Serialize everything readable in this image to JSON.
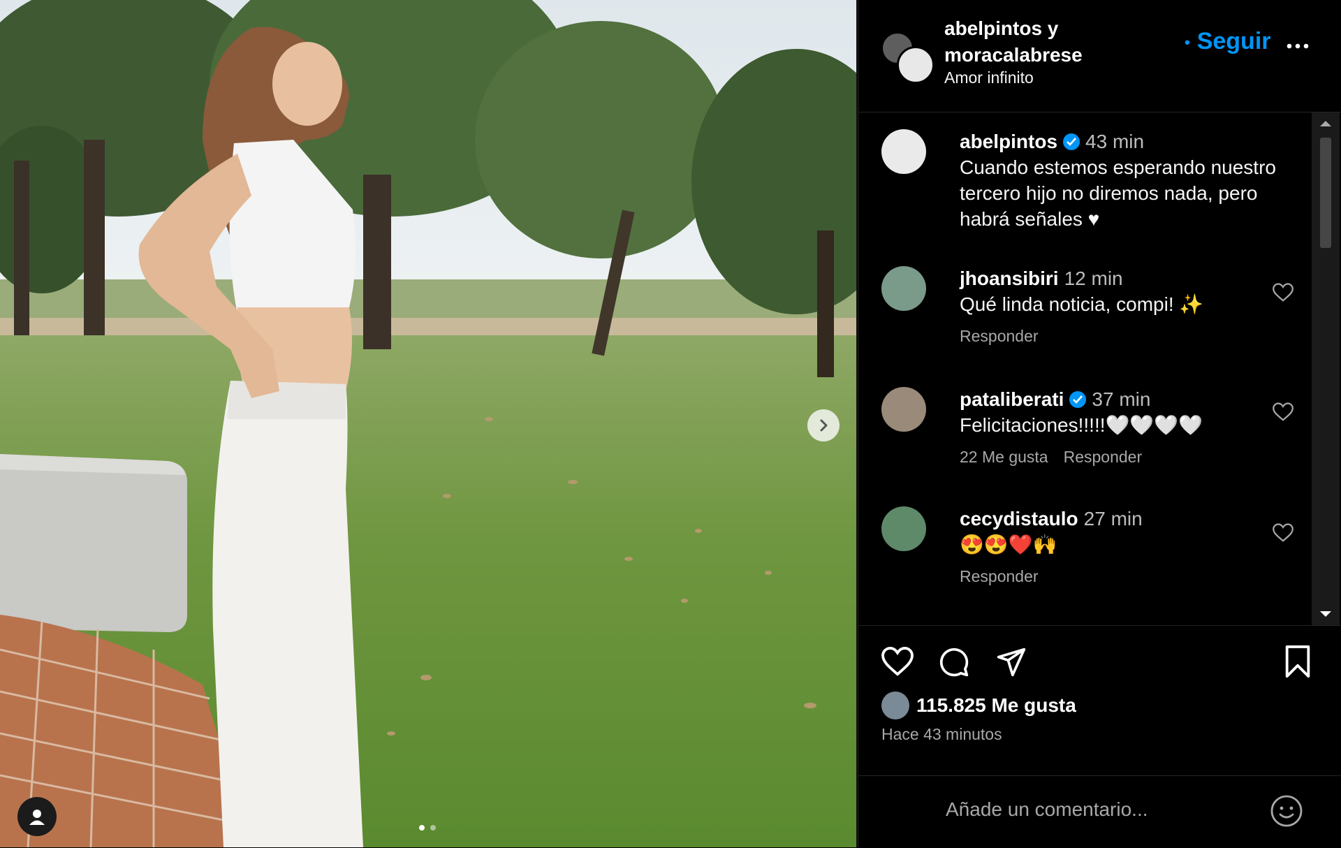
{
  "post": {
    "image_alt": "Photo of a woman in a white top and wide white trousers standing on a lawn with trees",
    "carousel_dots": 2,
    "icons": {
      "next": "chevron-right-icon",
      "tag": "user-tag-icon"
    }
  },
  "header": {
    "names_line1": "abelpintos y",
    "names_line2": "moracalabrese",
    "subtitle": "Amor infinito",
    "follow_label": "Seguir",
    "more_icon": "more-icon"
  },
  "caption": {
    "user": "abelpintos",
    "verified": true,
    "time": "43 min",
    "text": "Cuando estemos esperando nuestro tercero hijo no diremos nada, pero habrá señales ♥"
  },
  "comments": [
    {
      "user": "jhoansibiri",
      "verified": false,
      "time": "12 min",
      "text": "Qué linda noticia, compi! ✨",
      "likes": "",
      "reply": "Responder"
    },
    {
      "user": "pataliberati",
      "verified": true,
      "time": "37 min",
      "text": "Felicitaciones!!!!!🤍🤍🤍🤍",
      "likes": "22 Me gusta",
      "reply": "Responder"
    },
    {
      "user": "cecydistaulo",
      "verified": false,
      "time": "27 min",
      "text": "😍😍❤️🙌",
      "likes": "",
      "reply": "Responder"
    }
  ],
  "actions": {
    "icons": [
      "heart-icon",
      "comment-icon",
      "share-icon",
      "bookmark-icon"
    ],
    "likes": "115.825 Me gusta",
    "ago": "Hace 43 minutos"
  },
  "composer": {
    "placeholder": "Añade un comentario...",
    "emoji_icon": "emoji-icon"
  },
  "colors": {
    "accent": "#0095f6",
    "background": "#000000",
    "muted_text": "#a8a8a8"
  }
}
